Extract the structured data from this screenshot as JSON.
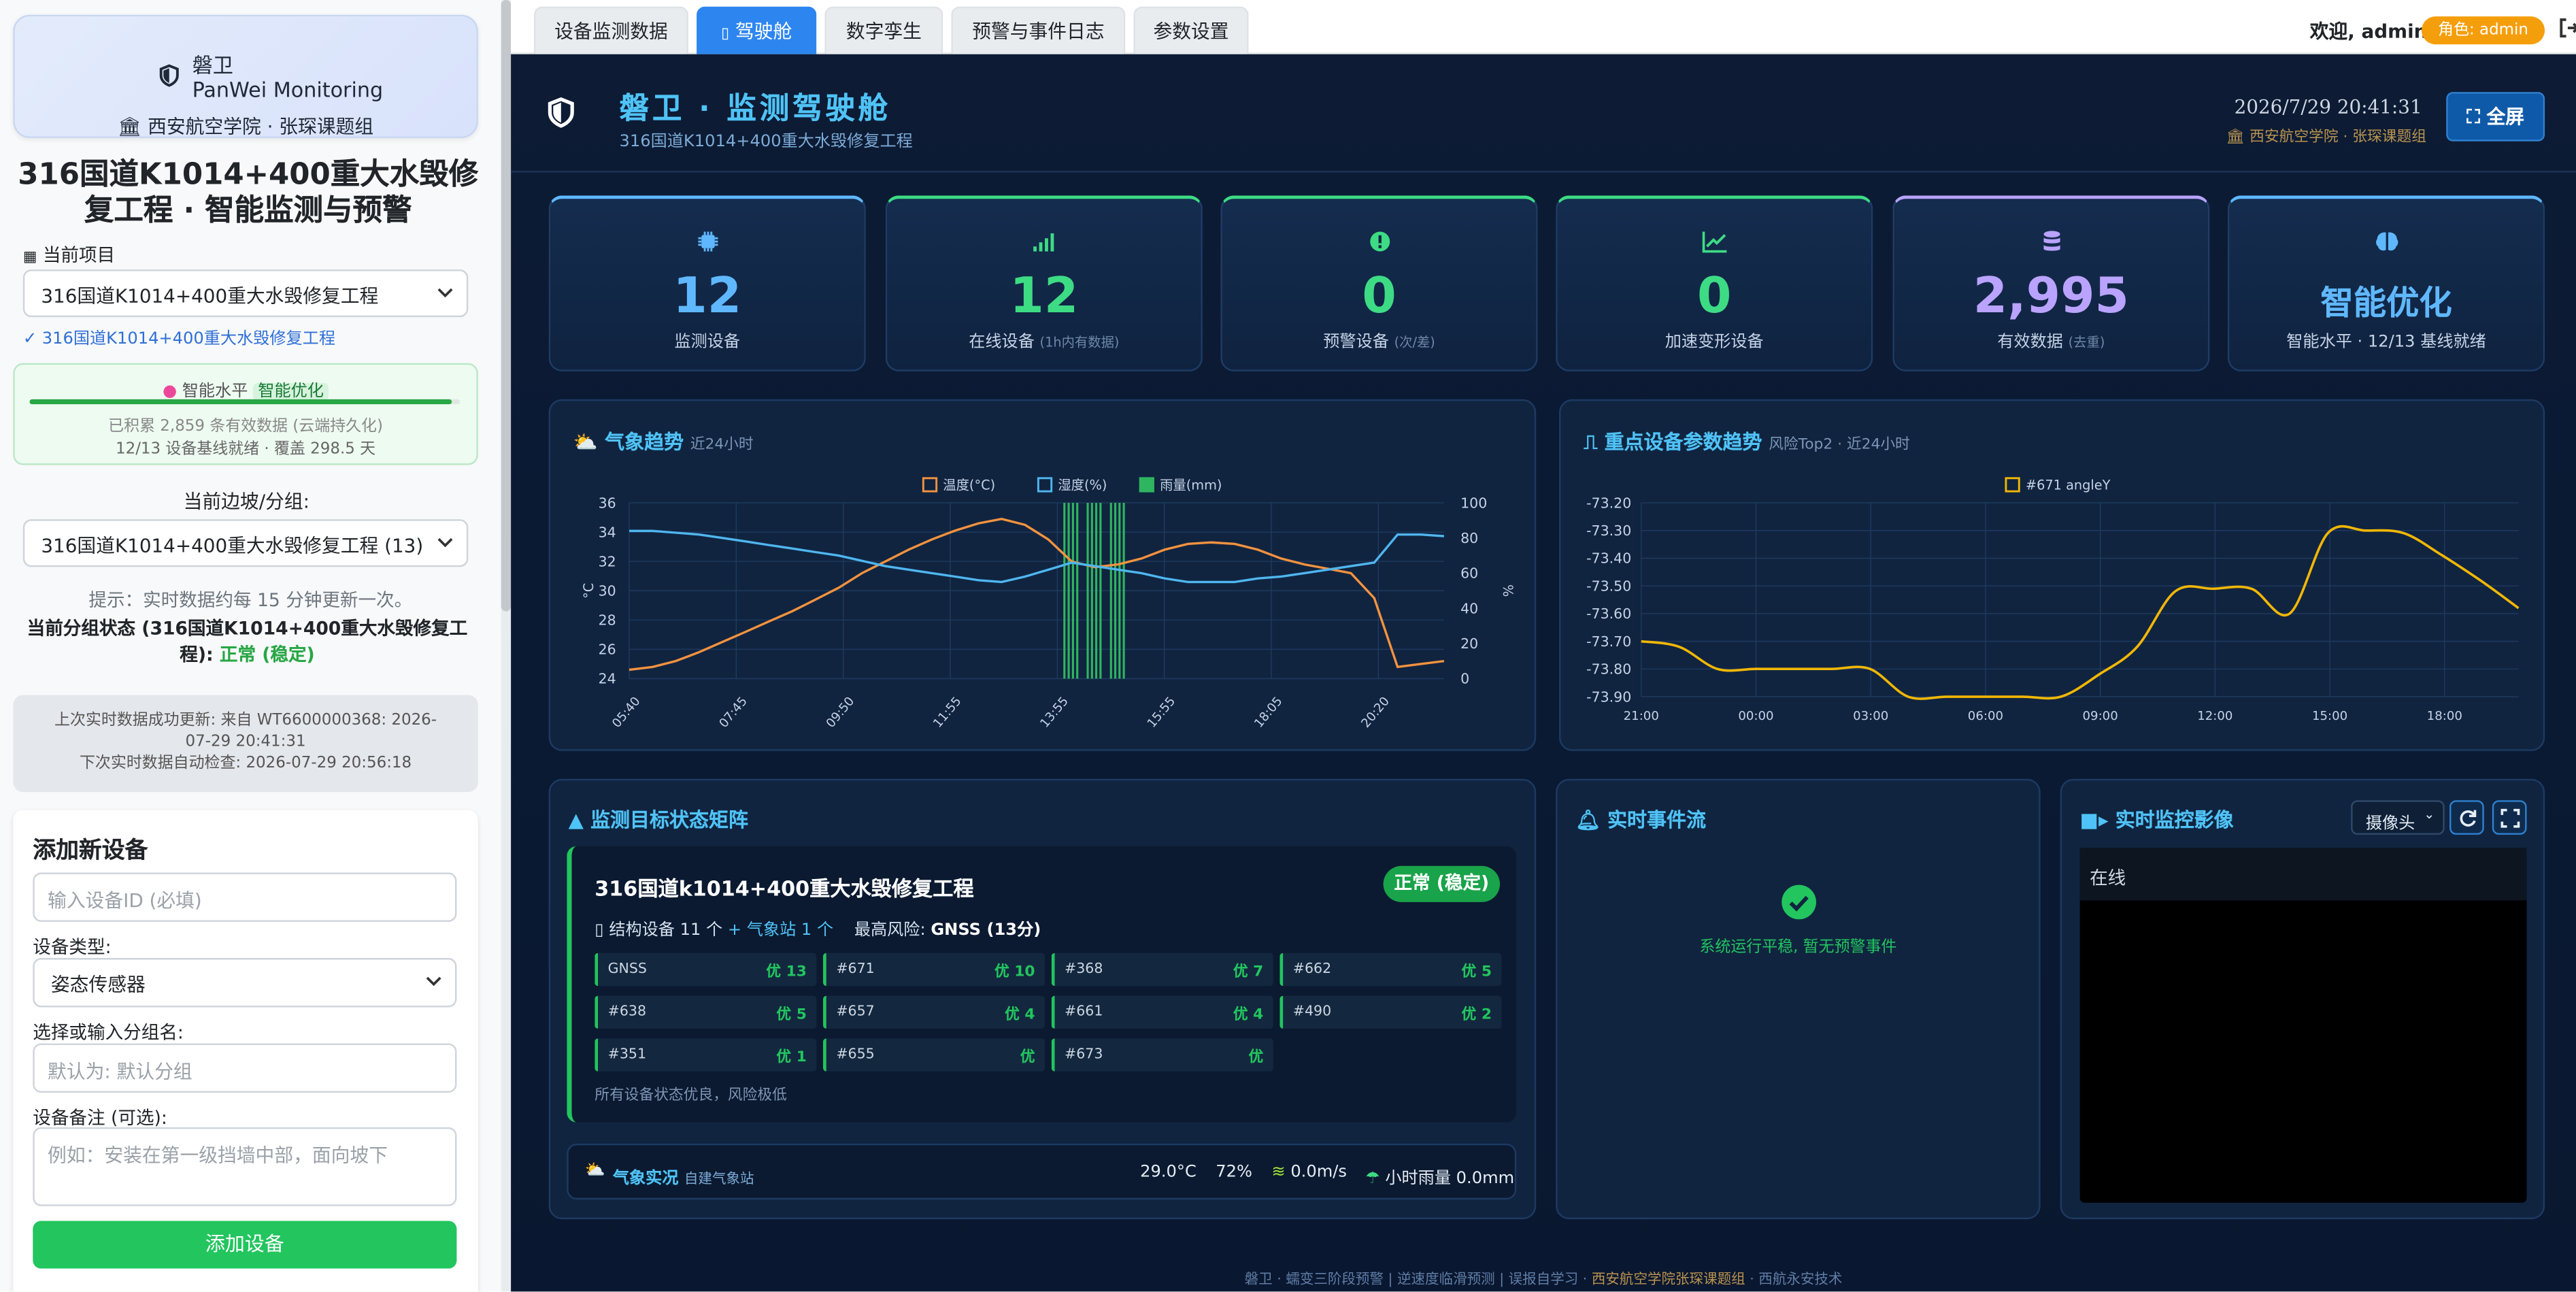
{
  "sidebar": {
    "brand": {
      "cn": "磐卫",
      "en": "PanWei Monitoring",
      "org": "西安航空学院 · 张琛课题组"
    },
    "project_title": "316国道K1014+400重大水毁修复工程 · 智能监测与预警",
    "current_project_label": "当前项目",
    "current_project_value": "316国道K1014+400重大水毁修复工程",
    "project_confirm": "✓ 316国道K1014+400重大水毁修复工程",
    "smart": {
      "label": "智能水平",
      "level": "智能优化",
      "progress": 0.98,
      "line1": "已积累 2,859 条有效数据 (云端持久化)",
      "line2": "12/13 设备基线就绪 · 覆盖 298.5 天"
    },
    "group_label": "当前边坡/分组:",
    "group_value": "316国道K1014+400重大水毁修复工程 (13)",
    "hint": "提示：实时数据约每 15 分钟更新一次。",
    "group_status_prefix": "当前分组状态 (316国道K1014+400重大水毁修复工程): ",
    "group_status_value": "正常 (稳定)",
    "last_update_1": "上次实时数据成功更新: 来自 WT6600000368: 2026-07-29 20:41:31",
    "last_update_2": "下次实时数据自动检查: 2026-07-29 20:56:18",
    "add_device": {
      "title": "添加新设备",
      "id_placeholder": "输入设备ID (必填)",
      "type_label": "设备类型:",
      "type_value": "姿态传感器",
      "group_label": "选择或输入分组名:",
      "group_placeholder": "默认为: 默认分组",
      "note_label": "设备备注 (可选):",
      "note_placeholder": "例如：安装在第一级挡墙中部，面向坡下",
      "submit": "添加设备"
    }
  },
  "topbar": {
    "tabs": [
      "设备监测数据",
      "驾驶舱",
      "数字孪生",
      "预警与事件日志",
      "参数设置"
    ],
    "active_tab": "驾驶舱",
    "welcome": "欢迎, admin",
    "role": "角色: admin"
  },
  "dashboard": {
    "title": "磐卫 · 监测驾驶舱",
    "subtitle": "316国道K1014+400重大水毁修复工程",
    "datetime": "2026/7/29 20:41:31",
    "org": "西安航空学院 · 张琛课题组",
    "fullscreen": "全屏",
    "kpis": [
      {
        "value": "12",
        "label": "监测设备",
        "note": "",
        "color": "#5fb8ff",
        "icon": "chip-icon"
      },
      {
        "value": "12",
        "label": "在线设备",
        "note": "(1h内有数据)",
        "color": "#3ddc84",
        "icon": "signal-icon"
      },
      {
        "value": "0",
        "label": "预警设备",
        "note": "(次/差)",
        "color": "#3ddc84",
        "icon": "alert-icon"
      },
      {
        "value": "0",
        "label": "加速变形设备",
        "note": "",
        "color": "#3ddc84",
        "icon": "trend-icon"
      },
      {
        "value": "2,995",
        "label": "有效数据",
        "note": "(去重)",
        "color": "#b9a3ff",
        "icon": "database-icon"
      },
      {
        "value": "智能优化",
        "label": "智能水平 · 12/13 基线就绪",
        "note": "",
        "color": "#5fb8ff",
        "icon": "brain-icon"
      }
    ],
    "weather_panel": {
      "title": "气象趋势",
      "sub": "近24小时"
    },
    "device_panel": {
      "title": "重点设备参数趋势",
      "sub": "风险Top2 · 近24小时"
    },
    "matrix_panel": {
      "title": "监测目标状态矩阵",
      "name": "316国道k1014+400重大水毁修复工程",
      "badge": "正常 (稳定)",
      "info_prefix": "结构设备 11 个",
      "info_station": "+ 气象站 1 个",
      "info_risk_label": "最高风险:",
      "info_risk_value": "GNSS (13分)",
      "cells": [
        {
          "id": "GNSS",
          "rating": "优 13"
        },
        {
          "id": "#671",
          "rating": "优 10"
        },
        {
          "id": "#368",
          "rating": "优 7"
        },
        {
          "id": "#662",
          "rating": "优 5"
        },
        {
          "id": "#638",
          "rating": "优 5"
        },
        {
          "id": "#657",
          "rating": "优 4"
        },
        {
          "id": "#661",
          "rating": "优 4"
        },
        {
          "id": "#490",
          "rating": "优 2"
        },
        {
          "id": "#351",
          "rating": "优 1"
        },
        {
          "id": "#655",
          "rating": "优"
        },
        {
          "id": "#673",
          "rating": "优"
        }
      ],
      "footer": "所有设备状态优良，风险极低"
    },
    "weather_now": {
      "title": "气象实况",
      "sub": "自建气象站",
      "temp": "29.0°C",
      "humidity": "72%",
      "wind": "0.0m/s",
      "rain": "小时雨量 0.0mm"
    },
    "events_panel": {
      "title": "实时事件流",
      "empty": "系统运行平稳, 暂无预警事件"
    },
    "camera_panel": {
      "title": "实时监控影像",
      "select": "摄像头",
      "status": "在线"
    },
    "footer": {
      "left": "磐卫 · 蠕变三阶段预警 | 逆速度临滑预测 | 误报自学习 · ",
      "org": "西安航空学院张琛课题组",
      "right": " · 西航永安技术"
    }
  },
  "chart_data": [
    {
      "type": "line",
      "title": "",
      "x_ticks": [
        "05:40",
        "07:45",
        "09:50",
        "11:55",
        "13:55",
        "15:55",
        "18:05",
        "20:20"
      ],
      "ylabel_left": "°C",
      "ylabel_right": "%",
      "ylim_left": [
        24,
        36
      ],
      "ylim_right": [
        0,
        100
      ],
      "yticks_left": [
        24,
        26,
        28,
        30,
        32,
        34,
        36
      ],
      "yticks_right": [
        0,
        20,
        40,
        60,
        80,
        100
      ],
      "legend_position": "top",
      "x": [
        "05:40",
        "06:00",
        "06:30",
        "07:00",
        "07:30",
        "08:00",
        "08:30",
        "09:00",
        "09:30",
        "10:00",
        "10:30",
        "11:00",
        "11:30",
        "12:00",
        "12:30",
        "13:00",
        "13:30",
        "14:00",
        "14:20",
        "14:45",
        "15:00",
        "15:15",
        "15:30",
        "16:00",
        "16:30",
        "17:00",
        "17:30",
        "18:00",
        "18:30",
        "19:00",
        "19:30",
        "20:00",
        "20:20",
        "20:40",
        "21:00",
        "21:20"
      ],
      "series": [
        {
          "name": "温度(°C)",
          "axis": "left",
          "color": "#f5923e",
          "values": [
            24.6,
            24.8,
            25.2,
            25.8,
            26.5,
            27.2,
            27.9,
            28.6,
            29.4,
            30.2,
            31.2,
            32.0,
            32.8,
            33.5,
            34.1,
            34.6,
            34.9,
            34.5,
            33.5,
            32.0,
            31.6,
            31.8,
            32.2,
            32.8,
            33.2,
            33.3,
            33.2,
            32.8,
            32.2,
            31.8,
            31.5,
            31.2,
            29.5,
            24.8,
            25.0,
            25.2
          ]
        },
        {
          "name": "湿度(%)",
          "axis": "right",
          "color": "#4fb6f0",
          "values": [
            84,
            84,
            83,
            82,
            80,
            78,
            76,
            74,
            72,
            70,
            67,
            64,
            62,
            60,
            58,
            56,
            55,
            58,
            62,
            66,
            64,
            62,
            60,
            57,
            55,
            55,
            55,
            57,
            58,
            60,
            62,
            64,
            66,
            82,
            82,
            81
          ]
        },
        {
          "name": "雨量(mm)",
          "axis": "right",
          "color": "#2fb55f",
          "values": [
            0,
            0,
            0,
            0,
            0,
            0,
            0,
            0,
            0,
            0,
            0,
            0,
            0,
            0,
            0,
            0,
            0,
            0,
            0,
            100,
            100,
            100,
            0,
            0,
            0,
            0,
            0,
            0,
            0,
            0,
            0,
            0,
            0,
            0,
            0,
            0
          ]
        }
      ]
    },
    {
      "type": "line",
      "title": "",
      "x_ticks": [
        "21:00",
        "00:00",
        "03:00",
        "06:00",
        "09:00",
        "12:00",
        "15:00",
        "18:00"
      ],
      "ylim": [
        -73.9,
        -73.2
      ],
      "yticks": [
        -73.2,
        -73.3,
        -73.4,
        -73.5,
        -73.6,
        -73.7,
        -73.8,
        -73.9
      ],
      "legend_position": "top",
      "x": [
        "21:00",
        "22:00",
        "23:00",
        "00:00",
        "01:00",
        "02:00",
        "03:00",
        "04:00",
        "05:00",
        "06:00",
        "07:00",
        "08:00",
        "09:00",
        "10:00",
        "11:00",
        "12:00",
        "13:00",
        "14:00",
        "15:00",
        "16:00",
        "17:00",
        "18:00",
        "19:00",
        "20:00"
      ],
      "series": [
        {
          "name": "#671 angleY",
          "color": "#f2b705",
          "values": [
            -73.7,
            -73.72,
            -73.8,
            -73.8,
            -73.8,
            -73.8,
            -73.8,
            -73.9,
            -73.9,
            -73.9,
            -73.9,
            -73.9,
            -73.82,
            -73.72,
            -73.52,
            -73.51,
            -73.51,
            -73.6,
            -73.31,
            -73.3,
            -73.31,
            -73.39,
            -73.48,
            -73.58
          ]
        }
      ]
    }
  ]
}
